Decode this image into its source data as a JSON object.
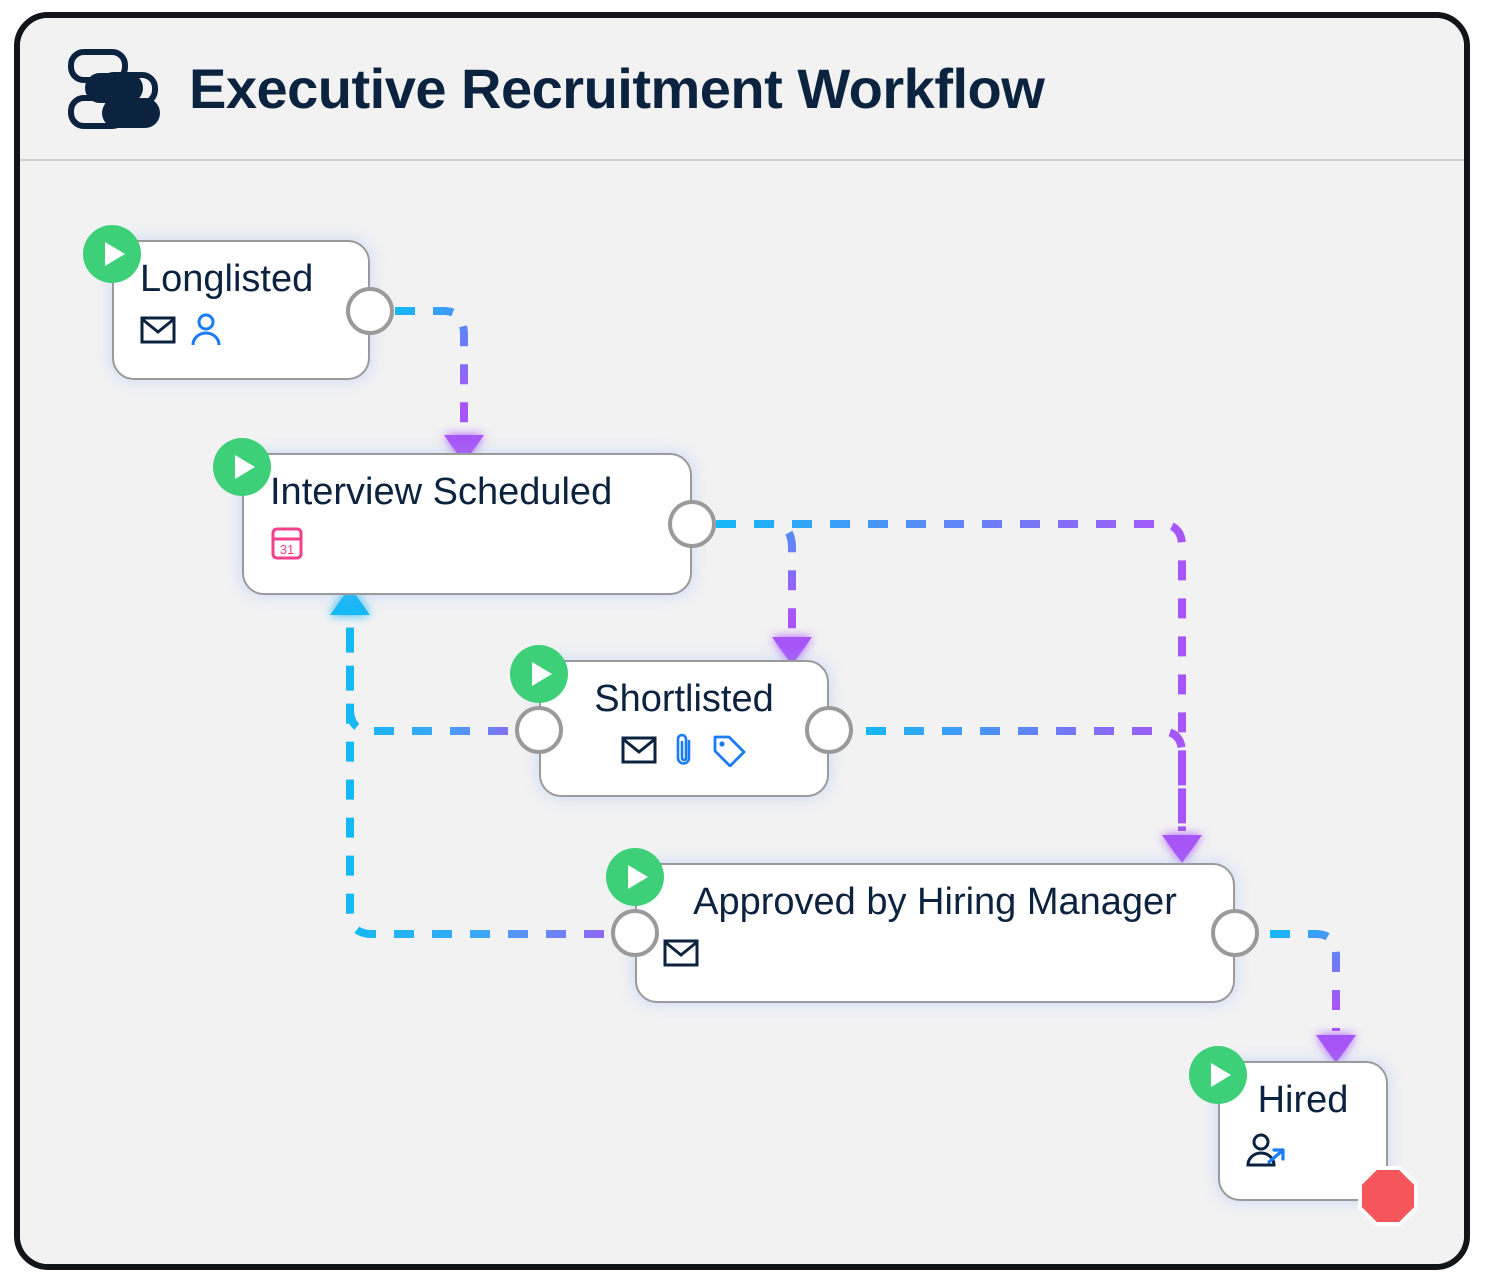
{
  "window": {
    "title": "Executive Recruitment Workflow",
    "logo_icon": "workflow-stack-icon",
    "frame_color": "#111418",
    "background_color": "#f2f2f3",
    "title_color": "#0c2340"
  },
  "legend": {
    "start_badge_icon": "play-icon",
    "start_badge_color": "#3ecf79",
    "stop_badge_icon": "stop-octagon-icon",
    "stop_badge_color": "#f4565b",
    "port_icon": "connection-port-icon",
    "port_color": "#9a9a9a"
  },
  "edge_style": {
    "dash": "dashed",
    "gradient_from": "#14b8f5",
    "gradient_to": "#a855f7",
    "arrow_forward_color": "#a855f7",
    "arrow_back_color": "#14b8f5"
  },
  "nodes": [
    {
      "id": "longlisted",
      "label": "Longlisted",
      "icons": [
        "envelope-icon",
        "person-icon"
      ],
      "start_badge": true,
      "stop_badge": false,
      "ports": [
        "right"
      ]
    },
    {
      "id": "interview-scheduled",
      "label": "Interview Scheduled",
      "icons": [
        "calendar-31-icon"
      ],
      "start_badge": true,
      "stop_badge": false,
      "ports": [
        "right"
      ]
    },
    {
      "id": "shortlisted",
      "label": "Shortlisted",
      "icons": [
        "envelope-icon",
        "paperclip-icon",
        "tag-icon"
      ],
      "start_badge": true,
      "stop_badge": false,
      "ports": [
        "left",
        "right"
      ]
    },
    {
      "id": "approved-by-hiring-manager",
      "label": "Approved by Hiring Manager",
      "icons": [
        "envelope-icon"
      ],
      "start_badge": true,
      "stop_badge": false,
      "ports": [
        "left",
        "right"
      ]
    },
    {
      "id": "hired",
      "label": "Hired",
      "icons": [
        "person-share-icon"
      ],
      "start_badge": true,
      "stop_badge": true,
      "ports": []
    }
  ],
  "edges": [
    {
      "from": "longlisted",
      "to": "interview-scheduled",
      "direction": "forward"
    },
    {
      "from": "interview-scheduled",
      "to": "shortlisted",
      "direction": "forward"
    },
    {
      "from": "interview-scheduled",
      "to": "approved-by-hiring-manager",
      "direction": "forward"
    },
    {
      "from": "shortlisted",
      "to": "approved-by-hiring-manager",
      "direction": "forward"
    },
    {
      "from": "shortlisted",
      "to": "interview-scheduled",
      "direction": "backward"
    },
    {
      "from": "approved-by-hiring-manager",
      "to": "interview-scheduled",
      "direction": "backward"
    },
    {
      "from": "approved-by-hiring-manager",
      "to": "hired",
      "direction": "forward"
    }
  ],
  "calendar_day": "31"
}
